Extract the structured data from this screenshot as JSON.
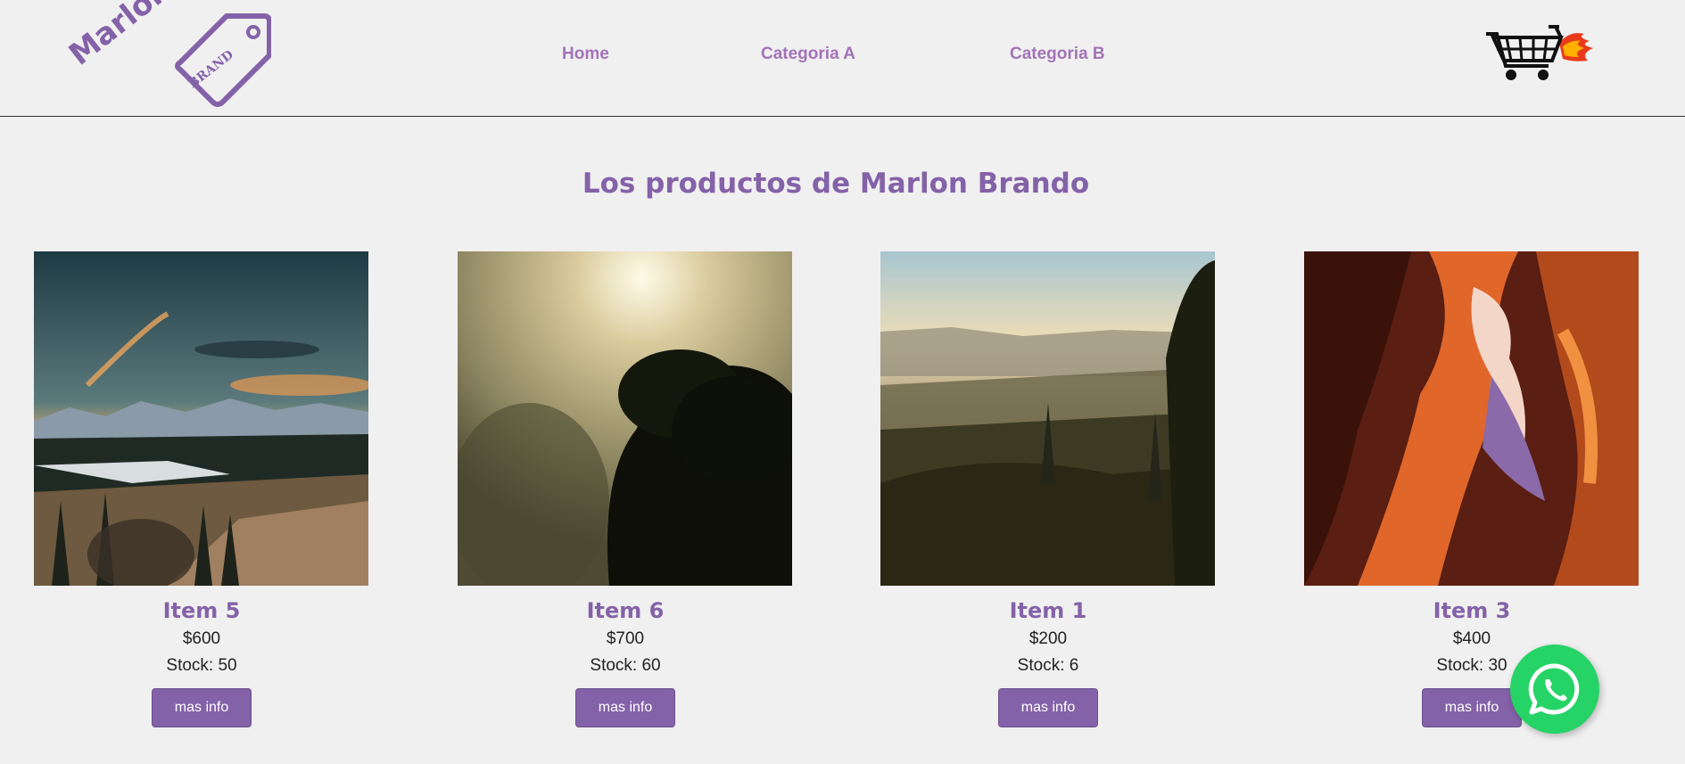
{
  "logo": {
    "word": "Marlon",
    "tag_text": "BRAND"
  },
  "nav": {
    "items": [
      {
        "label": "Home"
      },
      {
        "label": "Categoria A"
      },
      {
        "label": "Categoria B"
      }
    ],
    "cart_icon": "cart-with-flames-icon"
  },
  "page_title": "Los productos de Marlon Brando",
  "products": [
    {
      "title": "Item 5",
      "price": "$600",
      "stock": "Stock: 50",
      "button": "mas info",
      "image": "mountain-sunset-landscape"
    },
    {
      "title": "Item 6",
      "price": "$700",
      "stock": "Stock: 60",
      "button": "mas info",
      "image": "misty-sun-trees"
    },
    {
      "title": "Item 1",
      "price": "$200",
      "stock": "Stock: 6",
      "button": "mas info",
      "image": "hazy-valley-landscape"
    },
    {
      "title": "Item 3",
      "price": "$400",
      "stock": "Stock: 30",
      "button": "mas info",
      "image": "slot-canyon"
    }
  ],
  "floating": {
    "icon": "whatsapp-icon"
  },
  "colors": {
    "brand": "#8462a8",
    "nav": "#a273b8",
    "whatsapp": "#25d366",
    "background": "#f0f0f0"
  }
}
